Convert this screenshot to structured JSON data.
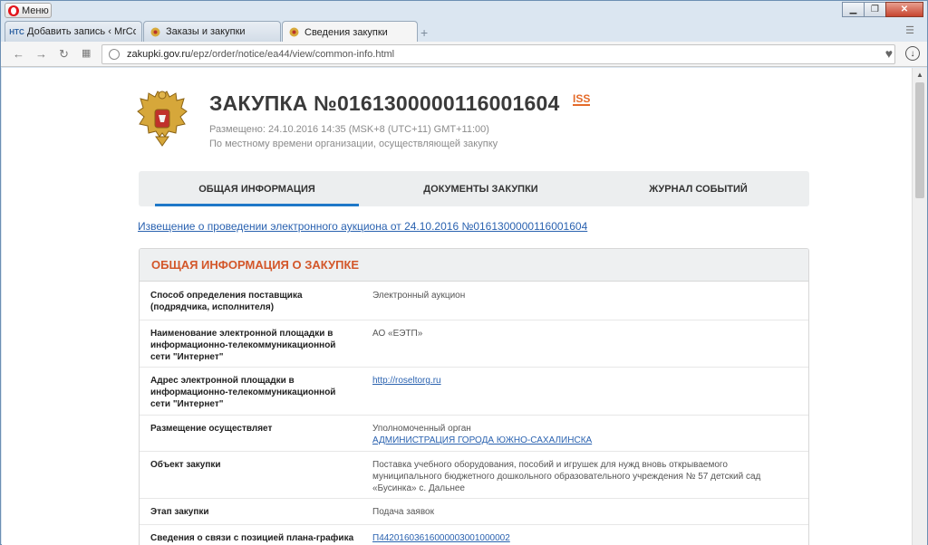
{
  "browser": {
    "menu_label": "Меню",
    "tabs": [
      {
        "label": "Добавить запись ‹ MrCoa",
        "favicon": "НТС"
      },
      {
        "label": "Заказы и закупки"
      },
      {
        "label": "Сведения закупки"
      }
    ],
    "url_host": "zakupki.gov.ru",
    "url_path": "/epz/order/notice/ea44/view/common-info.html",
    "new_tab_icon": "plus-icon"
  },
  "page": {
    "title": "ЗАКУПКА №0161300000116001604",
    "logo_text": "ISS",
    "posted": "Размещено: 24.10.2016 14:35 (MSK+8 (UTC+11) GMT+11:00)",
    "local_time_note": "По местному времени организации, осуществляющей закупку",
    "nav_tabs": [
      {
        "label": "ОБЩАЯ ИНФОРМАЦИЯ",
        "active": true
      },
      {
        "label": "ДОКУМЕНТЫ ЗАКУПКИ",
        "active": false
      },
      {
        "label": "ЖУРНАЛ СОБЫТИЙ",
        "active": false
      }
    ],
    "notice_link": "Извещение о проведении электронного аукциона от 24.10.2016 №0161300000116001604",
    "section_title": "ОБЩАЯ ИНФОРМАЦИЯ О ЗАКУПКЕ",
    "rows": [
      {
        "label": "Способ определения поставщика (подрядчика, исполнителя)",
        "value": "Электронный аукцион"
      },
      {
        "label": "Наименование электронной площадки в информационно-телекоммуникационной сети \"Интернет\"",
        "value": "АО «ЕЭТП»"
      },
      {
        "label": "Адрес электронной площадки в информационно-телекоммуникационной сети \"Интернет\"",
        "value": "http://roseltorg.ru"
      },
      {
        "label": "Размещение осуществляет",
        "value": "Уполномоченный орган",
        "value_link": "АДМИНИСТРАЦИЯ ГОРОДА ЮЖНО-САХАЛИНСКА"
      },
      {
        "label": "Объект закупки",
        "value": "Поставка учебного оборудования, пособий и игрушек для нужд вновь открываемого муниципального бюджетного дошкольного образовательного учреждения № 57 детский сад «Бусинка» с. Дальнее"
      },
      {
        "label": "Этап закупки",
        "value": "Подача заявок"
      },
      {
        "label": "Сведения о связи с позицией плана-графика",
        "value": "П44201603616000003001000002"
      }
    ]
  }
}
